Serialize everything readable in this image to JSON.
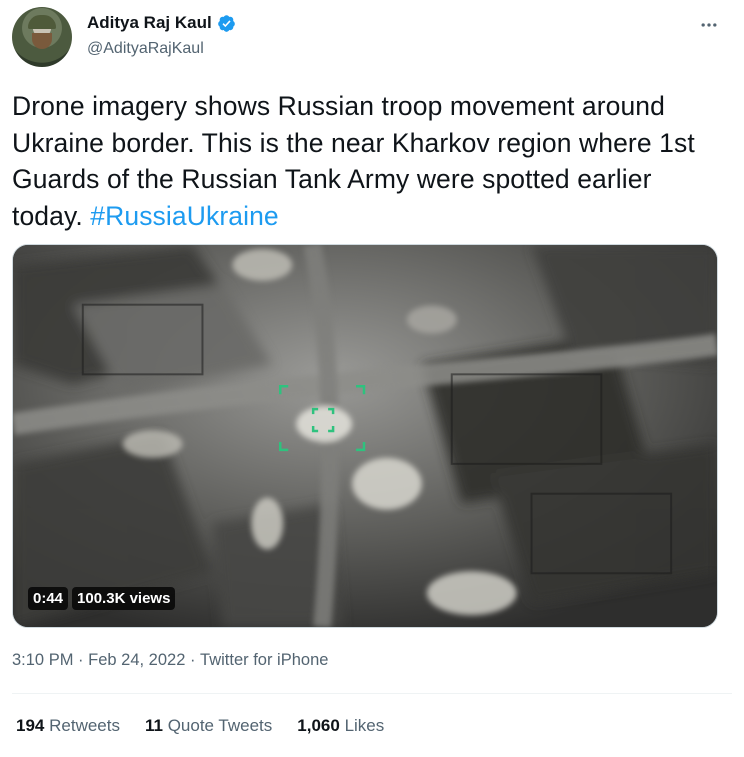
{
  "author": {
    "display_name": "Aditya Raj Kaul",
    "handle": "@AdityaRajKaul",
    "verified_icon": "verified-badge-icon",
    "avatar_icon": "profile-photo"
  },
  "more_icon": "more-horizontal-icon",
  "tweet": {
    "text_main": "Drone imagery shows Russian troop movement around Ukraine border. This is the near Kharkov region where 1st Guards of the Russian Tank Army were spotted earlier today. ",
    "hashtag": "#RussiaUkraine"
  },
  "media": {
    "duration": "0:44",
    "views": "100.3K views"
  },
  "meta": {
    "time": "3:10 PM",
    "sep1": " · ",
    "date": "Feb 24, 2022",
    "sep2": " · ",
    "source": "Twitter for iPhone"
  },
  "stats": {
    "retweets_count": "194",
    "retweets_label": "Retweets",
    "quotes_count": "11",
    "quotes_label": "Quote Tweets",
    "likes_count": "1,060",
    "likes_label": "Likes"
  },
  "colors": {
    "link": "#1d9bf0",
    "secondary_text": "#536471",
    "primary_text": "#0f1419",
    "targeting_reticle": "#2ec27e"
  }
}
